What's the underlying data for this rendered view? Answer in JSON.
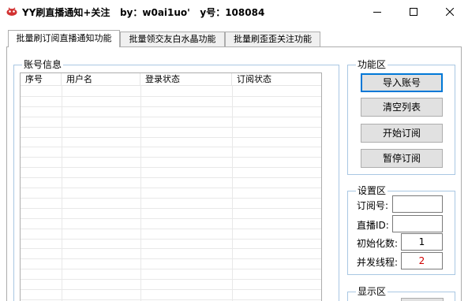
{
  "window": {
    "title": "YY刷直播通知+关注   by：w0ai1uo'   y号：108084"
  },
  "tabs": [
    {
      "label": "批量刷订阅直播通知功能",
      "active": true
    },
    {
      "label": "批量领交友白水晶功能",
      "active": false
    },
    {
      "label": "批量刷歪歪关注功能",
      "active": false
    }
  ],
  "account_group": {
    "title": "账号信息",
    "columns": [
      "序号",
      "用户名",
      "登录状态",
      "订阅状态"
    ]
  },
  "function_group": {
    "title": "功能区",
    "buttons": [
      "导入账号",
      "清空列表",
      "开始订阅",
      "暂停订阅"
    ]
  },
  "settings_group": {
    "title": "设置区",
    "fields": [
      {
        "label": "订阅号:",
        "value": ""
      },
      {
        "label": "直播ID:",
        "value": ""
      },
      {
        "label": "初始化数:",
        "value": "1"
      },
      {
        "label": "并发线程:",
        "value": "2"
      }
    ]
  },
  "display_group": {
    "title": "显示区"
  },
  "colors": {
    "group_border": "#a9c7e3",
    "thread_value": "#d00000",
    "focus_border": "#0078d7"
  }
}
